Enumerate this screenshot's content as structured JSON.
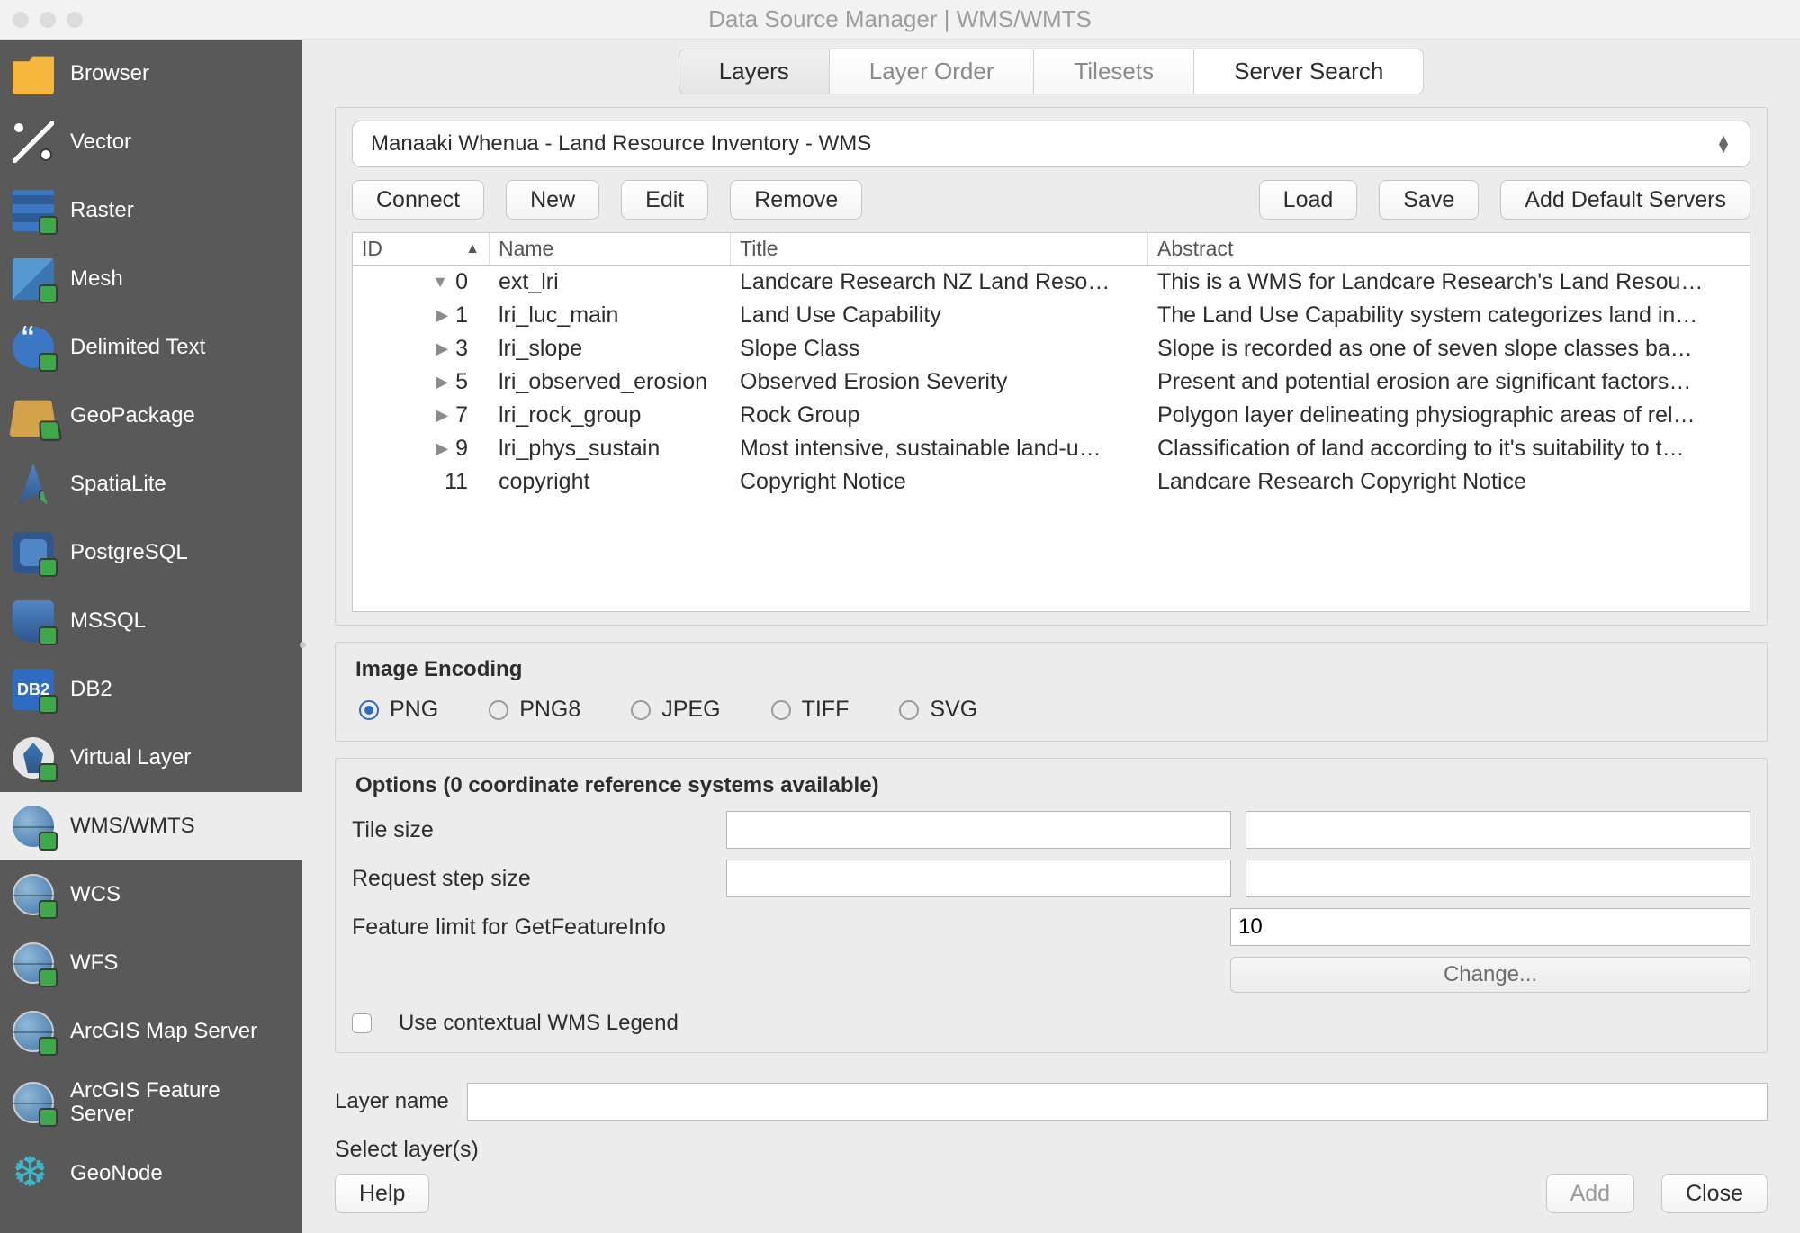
{
  "window": {
    "title": "Data Source Manager | WMS/WMTS"
  },
  "sidebar": {
    "items": [
      {
        "label": "Browser"
      },
      {
        "label": "Vector"
      },
      {
        "label": "Raster"
      },
      {
        "label": "Mesh"
      },
      {
        "label": "Delimited Text"
      },
      {
        "label": "GeoPackage"
      },
      {
        "label": "SpatiaLite"
      },
      {
        "label": "PostgreSQL"
      },
      {
        "label": "MSSQL"
      },
      {
        "label": "DB2"
      },
      {
        "label": "Virtual Layer"
      },
      {
        "label": "WMS/WMTS"
      },
      {
        "label": "WCS"
      },
      {
        "label": "WFS"
      },
      {
        "label": "ArcGIS Map Server"
      },
      {
        "label": "ArcGIS Feature Server"
      },
      {
        "label": "GeoNode"
      }
    ]
  },
  "tabs": {
    "layers": "Layers",
    "layer_order": "Layer Order",
    "tilesets": "Tilesets",
    "server_search": "Server Search"
  },
  "server": {
    "selected": "Manaaki Whenua - Land Resource Inventory - WMS"
  },
  "buttons": {
    "connect": "Connect",
    "new": "New",
    "edit": "Edit",
    "remove": "Remove",
    "load": "Load",
    "save": "Save",
    "add_default": "Add Default Servers",
    "change": "Change...",
    "help": "Help",
    "add": "Add",
    "close": "Close"
  },
  "table": {
    "headers": {
      "id": "ID",
      "name": "Name",
      "title": "Title",
      "abstract": "Abstract"
    },
    "rows": [
      {
        "disclose": "down",
        "id": "0",
        "name": "ext_lri",
        "title": "Landcare Research NZ Land Reso…",
        "abstract": "This is a WMS for Landcare Research's Land Resou…"
      },
      {
        "disclose": "right",
        "id": "1",
        "name": "lri_luc_main",
        "title": "Land Use Capability",
        "abstract": "The Land Use Capability system categorizes land in…"
      },
      {
        "disclose": "right",
        "id": "3",
        "name": "lri_slope",
        "title": "Slope Class",
        "abstract": "Slope is recorded as one of seven slope classes ba…"
      },
      {
        "disclose": "right",
        "id": "5",
        "name": "lri_observed_erosion",
        "title": "Observed Erosion Severity",
        "abstract": "Present and potential erosion are significant factors…"
      },
      {
        "disclose": "right",
        "id": "7",
        "name": "lri_rock_group",
        "title": "Rock Group",
        "abstract": "Polygon layer delineating physiographic areas of rel…"
      },
      {
        "disclose": "right",
        "id": "9",
        "name": "lri_phys_sustain",
        "title": "Most intensive, sustainable land-u…",
        "abstract": "Classification of land according to it's suitability to t…"
      },
      {
        "disclose": "none",
        "id": "11",
        "name": "copyright",
        "title": "Copyright Notice",
        "abstract": "Landcare Research Copyright Notice"
      }
    ]
  },
  "image_encoding": {
    "title": "Image Encoding",
    "options": {
      "png": "PNG",
      "png8": "PNG8",
      "jpeg": "JPEG",
      "tiff": "TIFF",
      "svg": "SVG"
    },
    "selected": "png"
  },
  "options": {
    "title": "Options (0 coordinate reference systems available)",
    "tile_size": "Tile size",
    "request_step": "Request step size",
    "feature_limit": "Feature limit for GetFeatureInfo",
    "feature_limit_value": "10",
    "use_contextual": "Use contextual WMS Legend"
  },
  "bottom": {
    "layer_name_label": "Layer name",
    "select_layers": "Select layer(s)"
  }
}
